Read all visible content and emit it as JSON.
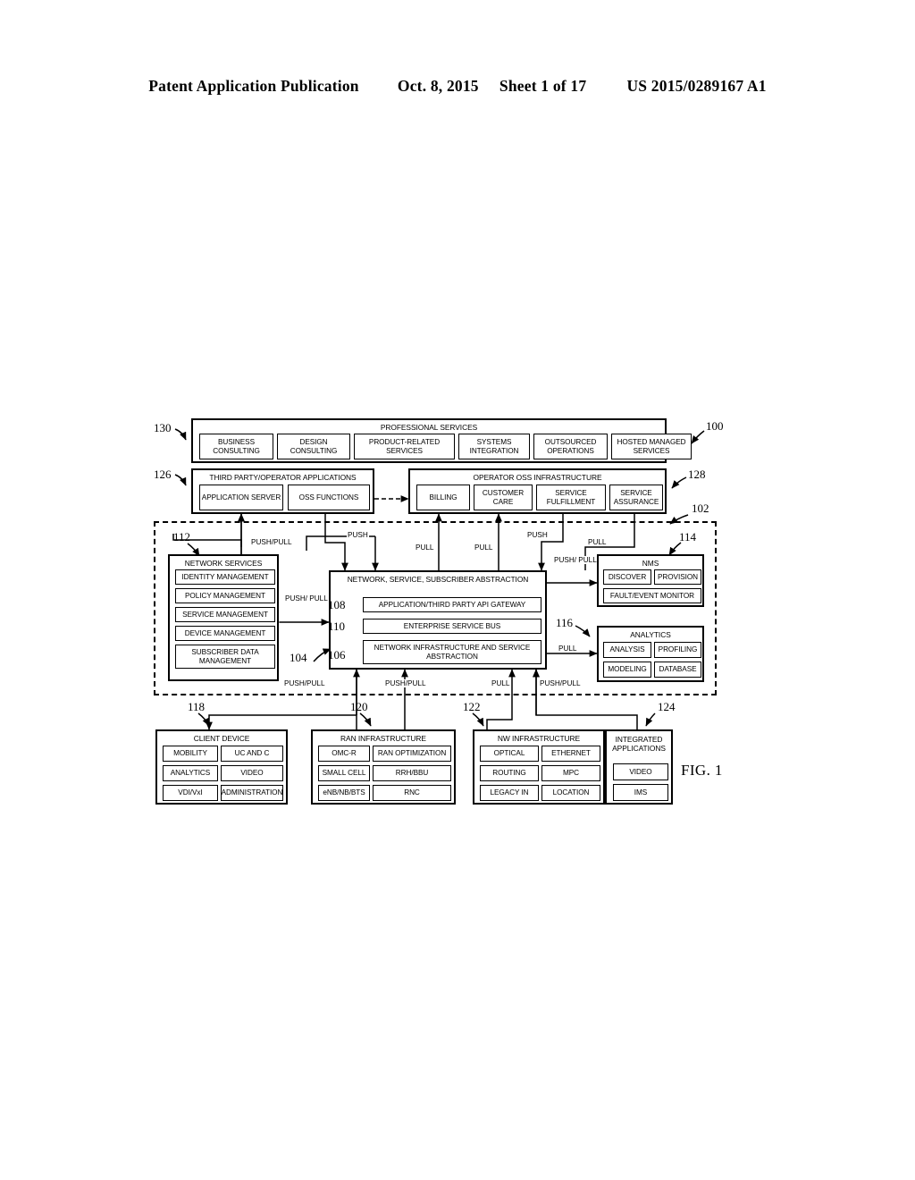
{
  "header": {
    "publication": "Patent Application Publication",
    "date": "Oct. 8, 2015",
    "sheet": "Sheet 1 of 17",
    "patent_number": "US 2015/0289167 A1"
  },
  "figure": {
    "label": "FIG. 1",
    "refs": {
      "r100": "100",
      "r102": "102",
      "r104": "104",
      "r106": "106",
      "r108": "108",
      "r110": "110",
      "r112": "112",
      "r114": "114",
      "r116": "116",
      "r118": "118",
      "r120": "120",
      "r122": "122",
      "r124": "124",
      "r126": "126",
      "r128": "128",
      "r130": "130"
    },
    "professional_services": {
      "title": "PROFESSIONAL SERVICES",
      "items": [
        "BUSINESS CONSULTING",
        "DESIGN CONSULTING",
        "PRODUCT-RELATED SERVICES",
        "SYSTEMS INTEGRATION",
        "OUTSOURCED OPERATIONS",
        "HOSTED MANAGED SERVICES"
      ]
    },
    "third_party_apps": {
      "title": "THIRD PARTY/OPERATOR APPLICATIONS",
      "items": [
        "APPLICATION SERVER",
        "OSS FUNCTIONS"
      ]
    },
    "operator_oss": {
      "title": "OPERATOR OSS INFRASTRUCTURE",
      "items": [
        "BILLING",
        "CUSTOMER CARE",
        "SERVICE FULFILLMENT",
        "SERVICE ASSURANCE"
      ]
    },
    "network_services": {
      "title": "NETWORK SERVICES",
      "items": [
        "IDENTITY MANAGEMENT",
        "POLICY MANAGEMENT",
        "SERVICE MANAGEMENT",
        "DEVICE MANAGEMENT",
        "SUBSCRIBER DATA MANAGEMENT"
      ]
    },
    "abstraction": {
      "title": "NETWORK, SERVICE, SUBSCRIBER ABSTRACTION",
      "layers": [
        "APPLICATION/THIRD PARTY API GATEWAY",
        "ENTERPRISE SERVICE BUS",
        "NETWORK INFRASTRUCTURE AND SERVICE ABSTRACTION"
      ]
    },
    "nms": {
      "title": "NMS",
      "items": [
        "DISCOVER",
        "PROVISION",
        "FAULT/EVENT MONITOR"
      ]
    },
    "analytics": {
      "title": "ANALYTICS",
      "items": [
        "ANALYSIS",
        "PROFILING",
        "MODELING",
        "DATABASE"
      ]
    },
    "client_device": {
      "title": "CLIENT DEVICE",
      "items": [
        "MOBILITY",
        "UC AND C",
        "ANALYTICS",
        "VIDEO",
        "VDI/VxI",
        "ADMINISTRATION"
      ]
    },
    "ran_infrastructure": {
      "title": "RAN INFRASTRUCTURE",
      "items": [
        "OMC-R",
        "RAN OPTIMIZATION",
        "SMALL CELL",
        "RRH/BBU",
        "eNB/NB/BTS",
        "RNC"
      ]
    },
    "nw_infrastructure": {
      "title": "NW INFRASTRUCTURE",
      "items": [
        "OPTICAL",
        "ETHERNET",
        "ROUTING",
        "MPC",
        "LEGACY IN",
        "LOCATION"
      ]
    },
    "integrated_applications": {
      "title": "INTEGRATED APPLICATIONS",
      "items": [
        "VIDEO",
        "IMS"
      ]
    },
    "flows": {
      "f1": "PUSH/PULL",
      "f2": "PUSH",
      "f3": "PULL",
      "f4": "PULL",
      "f5": "PUSH",
      "f6": "PULL",
      "f7": "PUSH/ PULL",
      "f8": "PUSH/ PULL",
      "f9": "PULL",
      "f10": "PUSH/PULL",
      "f11": "PUSH/PULL",
      "f12": "PULL",
      "f13": "PUSH/PULL"
    }
  }
}
